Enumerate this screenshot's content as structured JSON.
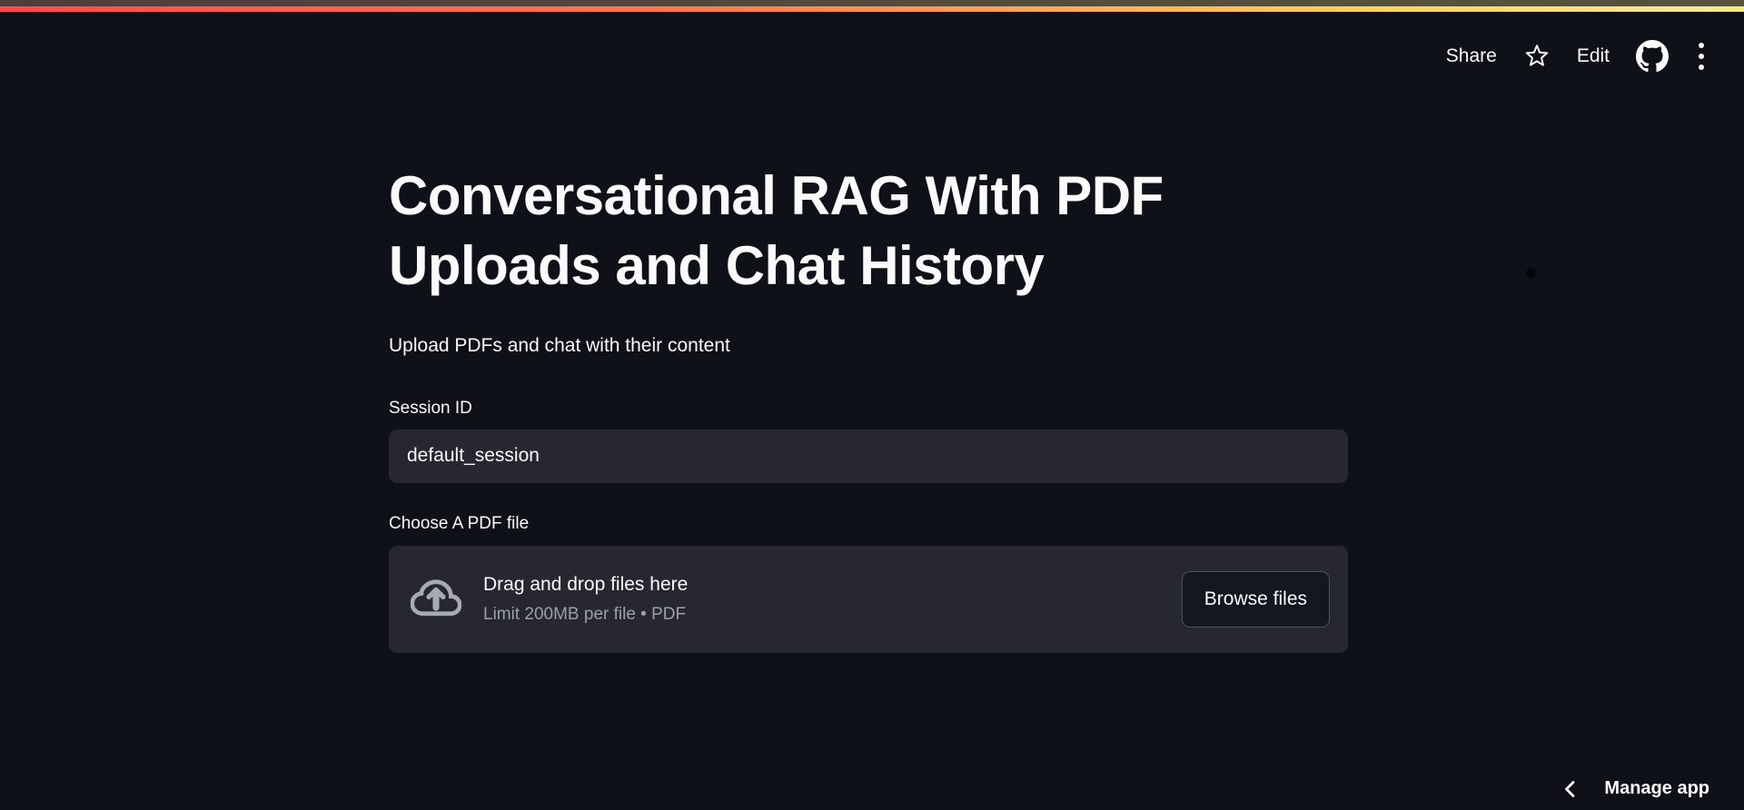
{
  "colors": {
    "bg": "#0e1117",
    "secondary_bg": "#262730",
    "text": "#fafafa",
    "muted": "#9aa0ab",
    "button_bg": "#131720",
    "accent_gradient": [
      "#ff4b4b",
      "#ff7a4e",
      "#ffd45e",
      "#f7e794"
    ]
  },
  "icons": {
    "star": "star-outline",
    "github": "github-mark",
    "overflow": "kebab-menu",
    "cloud": "cloud-upload",
    "chevron": "chevron-left"
  },
  "header": {
    "share_label": "Share",
    "edit_label": "Edit"
  },
  "main": {
    "title": "Conversational RAG With PDF Uploads and Chat History",
    "subtitle": "Upload PDFs and chat with their content",
    "session": {
      "label": "Session ID",
      "value": "default_session"
    },
    "uploader": {
      "label": "Choose A PDF file",
      "dropzone_title": "Drag and drop files here",
      "dropzone_hint": "Limit 200MB per file • PDF",
      "browse_label": "Browse files"
    }
  },
  "footer": {
    "manage_label": "Manage app"
  }
}
